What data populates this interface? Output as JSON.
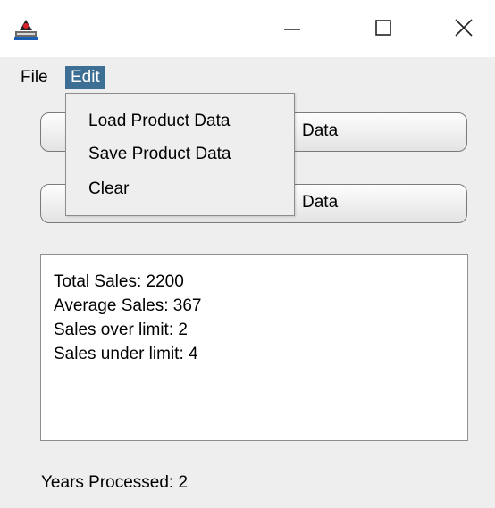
{
  "window": {
    "icon": "java-duke-icon",
    "controls": {
      "minimize": "minimize-icon",
      "maximize": "maximize-icon",
      "close": "close-icon"
    }
  },
  "menubar": {
    "file_label": "File",
    "edit_label": "Edit",
    "edit_selected_color": "#3d6e94"
  },
  "edit_menu": {
    "items": [
      "Load Product Data",
      "Save Product Data",
      "Clear"
    ]
  },
  "buttons": {
    "first_visible_label": "Data",
    "second_visible_label": "Data"
  },
  "output": {
    "lines": [
      "Total Sales: 2200",
      "Average Sales: 367",
      "Sales over limit: 2",
      "Sales under limit: 4"
    ]
  },
  "status": {
    "years_processed": "Years Processed: 2"
  }
}
